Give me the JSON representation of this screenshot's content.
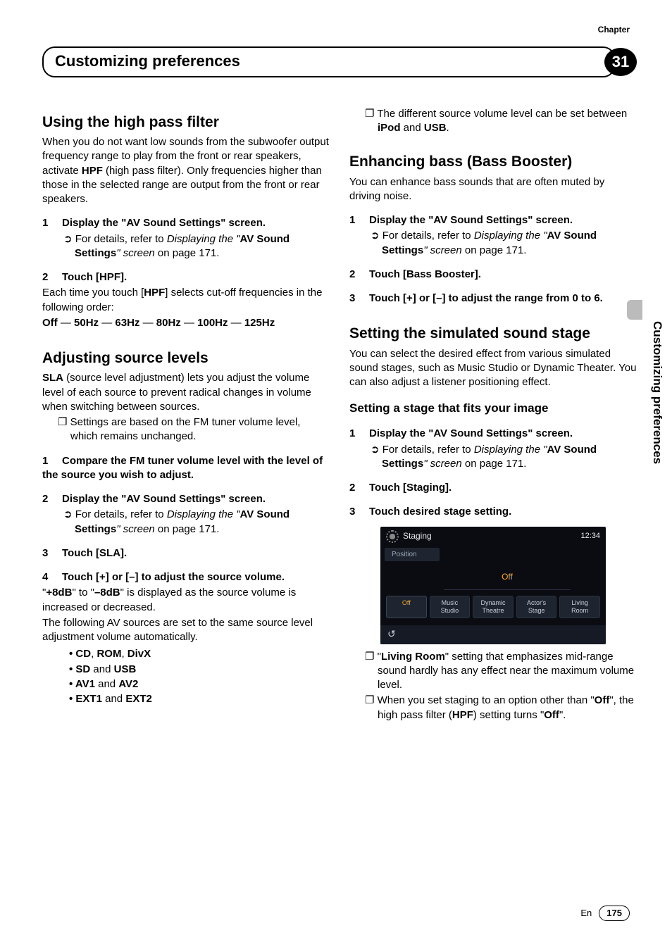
{
  "chapter": {
    "label": "Chapter",
    "number": "31",
    "title": "Customizing preferences"
  },
  "sideTab": "Customizing preferences",
  "footer": {
    "lang": "En",
    "page": "175"
  },
  "left": {
    "hpf": {
      "heading": "Using the high pass filter",
      "intro_a": "When you do not want low sounds from the subwoofer output frequency range to play from the front or rear speakers, activate ",
      "intro_hpf": "HPF",
      "intro_b": " (high pass filter). Only frequencies higher than those in the selected range are output from the front or rear speakers.",
      "s1_num": "1",
      "s1_a": "Display the ",
      "s1_q1": "\"",
      "s1_label": "AV Sound Settings",
      "s1_q2": "\"",
      "s1_b": " screen.",
      "s1_ref_a": "For details, refer to ",
      "s1_ref_i1": "Displaying the ",
      "s1_ref_q1": "\"",
      "s1_ref_b": "AV Sound Settings",
      "s1_ref_q2": "\"",
      "s1_ref_i2": " screen",
      "s1_ref_c": " on page 171.",
      "s2_num": "2",
      "s2": "Touch [HPF].",
      "s2_desc_a": "Each time you touch [",
      "s2_desc_hpf": "HPF",
      "s2_desc_b": "] selects cut-off frequencies in the following order:",
      "seq_off": "Off",
      "seq_dash1": " — ",
      "seq_50": "50Hz",
      "seq_dash2": " — ",
      "seq_63": "63Hz",
      "seq_dash3": " — ",
      "seq_80": "80Hz",
      "seq_dash4": " — ",
      "seq_100": "100Hz",
      "seq_dash5": " — ",
      "seq_125": "125Hz"
    },
    "sla": {
      "heading": "Adjusting source levels",
      "intro_b1": "SLA",
      "intro_a": " (source level adjustment) lets you adjust the volume level of each source to prevent radical changes in volume when switching between sources.",
      "note1": "Settings are based on the FM tuner volume level, which remains unchanged.",
      "s1_num": "1",
      "s1": "Compare the FM tuner volume level with the level of the source you wish to adjust.",
      "s2_num": "2",
      "s2_a": "Display the ",
      "s2_q1": "\"",
      "s2_label": "AV Sound Settings",
      "s2_q2": "\"",
      "s2_b": " screen.",
      "s2_ref_a": "For details, refer to ",
      "s2_ref_i1": "Displaying the ",
      "s2_ref_q1": "\"",
      "s2_ref_b": "AV Sound Settings",
      "s2_ref_q2": "\"",
      "s2_ref_i2": " screen",
      "s2_ref_c": " on page 171.",
      "s3_num": "3",
      "s3": "Touch [SLA].",
      "s4_num": "4",
      "s4": "Touch [+] or [–] to adjust the source volume.",
      "s4_desc_q1": "\"",
      "s4_desc_p8": "+8dB",
      "s4_desc_mid": "\" to \"",
      "s4_desc_m8": "–8dB",
      "s4_desc_end": "\" is displayed as the source volume is increased or decreased.",
      "auto": "The following AV sources are set to the same source level adjustment volume automatically.",
      "li1_a": "CD",
      "li1_c1": ", ",
      "li1_b": "ROM",
      "li1_c2": ", ",
      "li1_d": "DivX",
      "li2_a": "SD",
      "li2_and": " and ",
      "li2_b": "USB",
      "li3_a": "AV1",
      "li3_and": " and ",
      "li3_b": "AV2",
      "li4_a": "EXT1",
      "li4_and": " and ",
      "li4_b": "EXT2"
    }
  },
  "right": {
    "topnote_a": "The different source volume level can be set between ",
    "topnote_ipod": "iPod",
    "topnote_and": " and ",
    "topnote_usb": "USB",
    "topnote_dot": ".",
    "bass": {
      "heading_a": "Enhancing bass (",
      "heading_sub": "Bass Booster",
      "heading_b": ")",
      "intro": "You can enhance bass sounds that are often muted by driving noise.",
      "s1_num": "1",
      "s1_a": "Display the ",
      "s1_q1": "\"",
      "s1_label": "AV Sound Settings",
      "s1_q2": "\"",
      "s1_b": " screen.",
      "s1_ref_a": "For details, refer to ",
      "s1_ref_i1": "Displaying the ",
      "s1_ref_q1": "\"",
      "s1_ref_b": "AV Sound Settings",
      "s1_ref_q2": "\"",
      "s1_ref_i2": " screen",
      "s1_ref_c": " on page 171.",
      "s2_num": "2",
      "s2": "Touch [Bass Booster].",
      "s3_num": "3",
      "s3": "Touch [+] or [–] to adjust the range from 0 to 6."
    },
    "stage": {
      "heading": "Setting the simulated sound stage",
      "intro": "You can select the desired effect from various simulated sound stages, such as Music Studio or Dynamic Theater. You can also adjust a listener positioning effect.",
      "sub": "Setting a stage that fits your image",
      "s1_num": "1",
      "s1_a": "Display the ",
      "s1_q1": "\"",
      "s1_label": "AV Sound Settings",
      "s1_q2": "\"",
      "s1_b": " screen.",
      "s1_ref_a": "For details, refer to ",
      "s1_ref_i1": "Displaying the ",
      "s1_ref_q1": "\"",
      "s1_ref_b": "AV Sound Settings",
      "s1_ref_q2": "\"",
      "s1_ref_i2": " screen",
      "s1_ref_c": " on page 171.",
      "s2_num": "2",
      "s2": "Touch [Staging].",
      "s3_num": "3",
      "s3": "Touch desired stage setting.",
      "ss": {
        "title": "Staging",
        "time": "12:34",
        "position": "Position",
        "off": "Off",
        "b1": "Off",
        "b2a": "Music",
        "b2b": "Studio",
        "b3a": "Dynamic",
        "b3b": "Theatre",
        "b4a": "Actor's",
        "b4b": "Stage",
        "b5a": "Living",
        "b5b": "Room",
        "back": "↺"
      },
      "n1_q1": "\"",
      "n1_lr": "Living Room",
      "n1_q2": "\"",
      "n1_rest": " setting that emphasizes mid-range sound hardly has any effect near the maximum volume level.",
      "n2_a": "When you set staging to an option other than ",
      "n2_q1": "\"",
      "n2_off": "Off",
      "n2_q2": "\"",
      "n2_b": ", the high pass filter (",
      "n2_hpf": "HPF",
      "n2_c": ") setting turns ",
      "n2_q3": "\"",
      "n2_off2": "Off",
      "n2_q4": "\"",
      "n2_dot": "."
    }
  }
}
